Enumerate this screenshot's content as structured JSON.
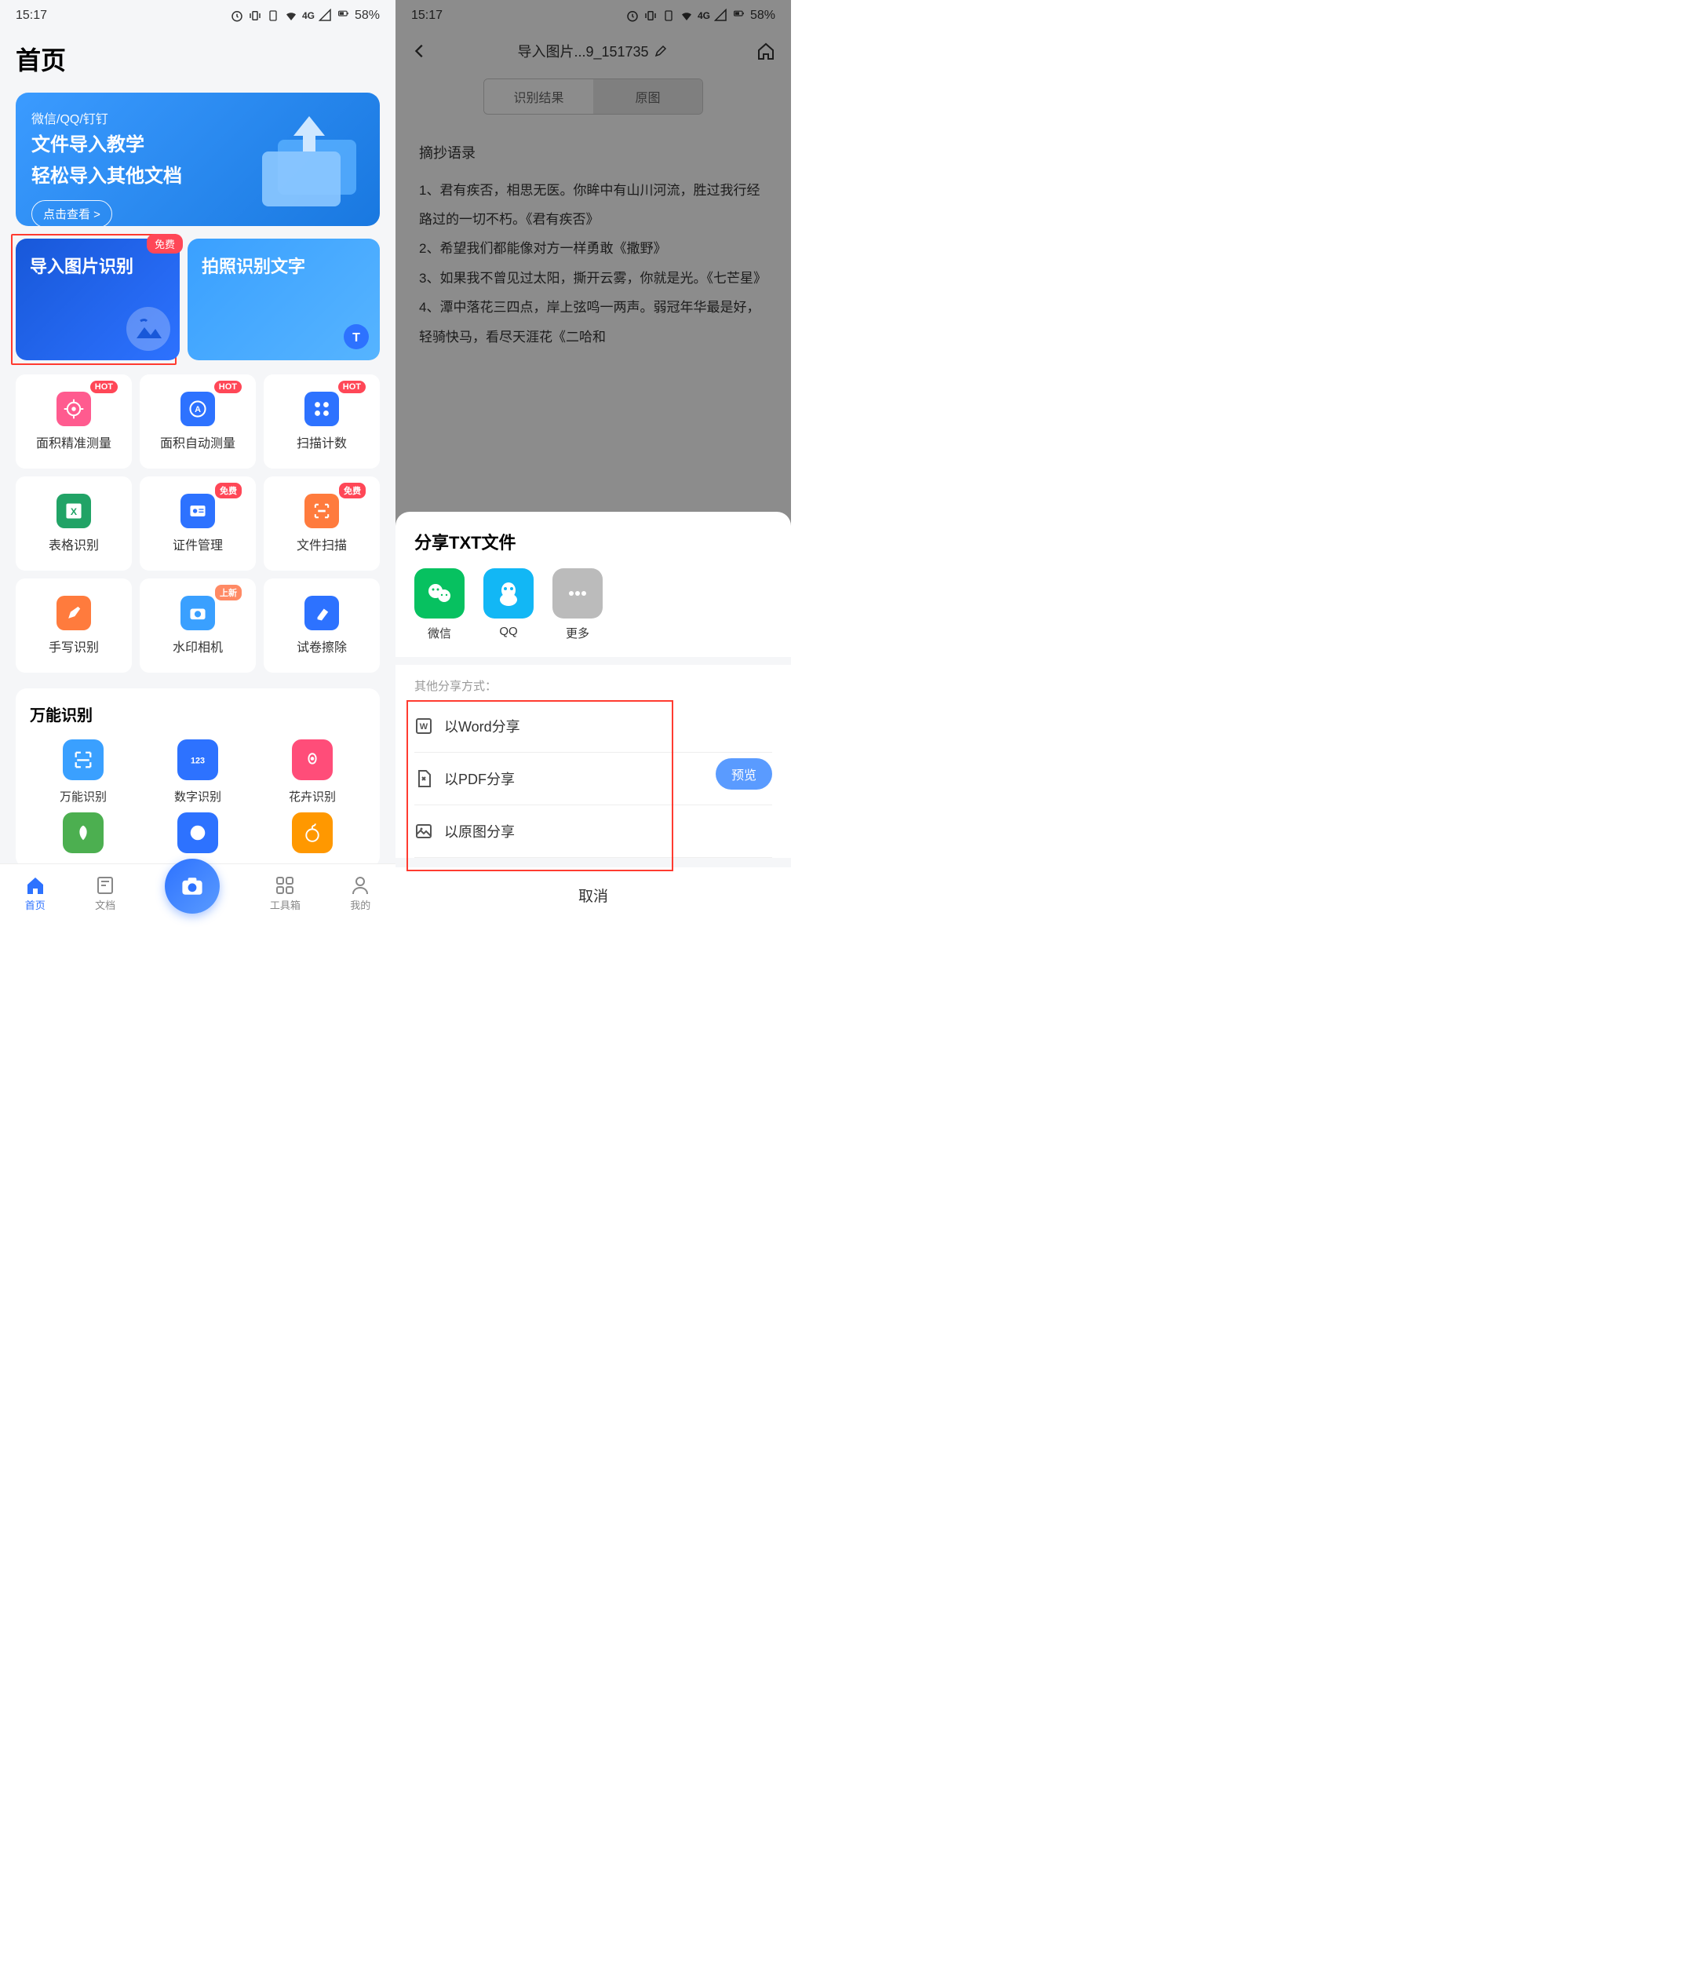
{
  "status": {
    "time": "15:17",
    "battery": "58%",
    "network": "4G"
  },
  "left": {
    "title": "首页",
    "banner": {
      "sub": "微信/QQ/钉钉",
      "line1": "文件导入教学",
      "line2": "轻松导入其他文档",
      "cta": "点击查看 >"
    },
    "feature1": {
      "label": "导入图片识别",
      "badge": "免费"
    },
    "feature2": {
      "label": "拍照识别文字"
    },
    "tools": [
      {
        "label": "面积精准测量",
        "badge": "HOT",
        "color": "#ff5b8f"
      },
      {
        "label": "面积自动测量",
        "badge": "HOT",
        "color": "#2d72ff"
      },
      {
        "label": "扫描计数",
        "badge": "HOT",
        "color": "#2d72ff"
      },
      {
        "label": "表格识别",
        "badge": "",
        "color": "#21a366"
      },
      {
        "label": "证件管理",
        "badge": "免费",
        "color": "#2d72ff"
      },
      {
        "label": "文件扫描",
        "badge": "免费",
        "color": "#ff7b3d"
      },
      {
        "label": "手写识别",
        "badge": "",
        "color": "#ff7b3d"
      },
      {
        "label": "水印相机",
        "badge": "上新",
        "color": "#3aa0ff"
      },
      {
        "label": "试卷擦除",
        "badge": "",
        "color": "#2d72ff"
      }
    ],
    "section": {
      "title": "万能识别",
      "items": [
        {
          "label": "万能识别",
          "color": "#3aa0ff"
        },
        {
          "label": "数字识别",
          "color": "#2d72ff"
        },
        {
          "label": "花卉识别",
          "color": "#ff4d79"
        },
        {
          "label": "",
          "color": "#4caf50"
        },
        {
          "label": "",
          "color": "#2d72ff"
        },
        {
          "label": "",
          "color": "#ff9800"
        }
      ]
    },
    "nav": {
      "home": "首页",
      "docs": "文档",
      "tools": "工具箱",
      "mine": "我的"
    }
  },
  "right": {
    "title": "导入图片...9_151735",
    "tab1": "识别结果",
    "tab2": "原图",
    "heading": "摘抄语录",
    "body": "1、君有疾否，相思无医。你眸中有山川河流，胜过我行经路过的一切不朽。《君有疾否》\n2、希望我们都能像对方一样勇敢《撒野》\n3、如果我不曾见过太阳，撕开云雾，你就是光。《七芒星》\n4、潭中落花三四点，岸上弦鸣一两声。弱冠年华最是好，轻骑快马，看尽天涯花《二哈和",
    "share": {
      "title": "分享TXT文件",
      "apps": [
        {
          "label": "微信",
          "color": "#07c160"
        },
        {
          "label": "QQ",
          "color": "#12b7f5"
        },
        {
          "label": "更多",
          "color": "#bbb"
        }
      ],
      "otherTitle": "其他分享方式：",
      "options": [
        "以Word分享",
        "以PDF分享",
        "以原图分享"
      ],
      "preview": "预览",
      "cancel": "取消"
    }
  }
}
